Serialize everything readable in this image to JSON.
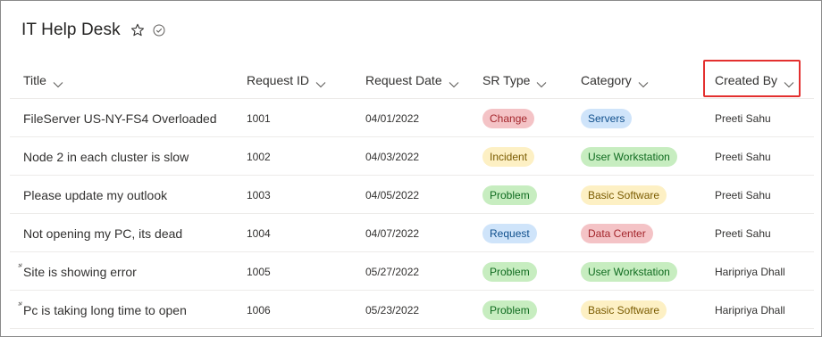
{
  "list": {
    "title": "IT Help Desk"
  },
  "columns": [
    {
      "key": "title",
      "label": "Title"
    },
    {
      "key": "request_id",
      "label": "Request ID"
    },
    {
      "key": "request_date",
      "label": "Request Date"
    },
    {
      "key": "sr_type",
      "label": "SR Type"
    },
    {
      "key": "category",
      "label": "Category"
    },
    {
      "key": "created_by",
      "label": "Created By"
    }
  ],
  "pill_colors": {
    "Change": {
      "bg": "#f4c3c6",
      "fg": "#a4262c"
    },
    "Incident": {
      "bg": "#fdf0c4",
      "fg": "#7a5b00"
    },
    "Problem": {
      "bg": "#c7edc0",
      "fg": "#0f6b1f"
    },
    "Request": {
      "bg": "#cfe4fa",
      "fg": "#0f4f8c"
    },
    "Servers": {
      "bg": "#cfe4fa",
      "fg": "#0f4f8c"
    },
    "User Workstation": {
      "bg": "#c7edc0",
      "fg": "#0f6b1f"
    },
    "Basic Software": {
      "bg": "#fdf0c4",
      "fg": "#7a5b00"
    },
    "Data Center": {
      "bg": "#f4c3c6",
      "fg": "#a4262c"
    }
  },
  "rows": [
    {
      "title": "FileServer US-NY-FS4 Overloaded",
      "request_id": "1001",
      "request_date": "04/01/2022",
      "sr_type": "Change",
      "category": "Servers",
      "created_by": "Preeti Sahu",
      "new_marker": false
    },
    {
      "title": "Node 2 in each cluster is slow",
      "request_id": "1002",
      "request_date": "04/03/2022",
      "sr_type": "Incident",
      "category": "User Workstation",
      "created_by": "Preeti Sahu",
      "new_marker": false
    },
    {
      "title": "Please update my outlook",
      "request_id": "1003",
      "request_date": "04/05/2022",
      "sr_type": "Problem",
      "category": "Basic Software",
      "created_by": "Preeti Sahu",
      "new_marker": false
    },
    {
      "title": "Not opening my PC, its dead",
      "request_id": "1004",
      "request_date": "04/07/2022",
      "sr_type": "Request",
      "category": "Data Center",
      "created_by": "Preeti Sahu",
      "new_marker": false
    },
    {
      "title": "Site is showing error",
      "request_id": "1005",
      "request_date": "05/27/2022",
      "sr_type": "Problem",
      "category": "User Workstation",
      "created_by": "Haripriya Dhall",
      "new_marker": true
    },
    {
      "title": "Pc is taking long time to open",
      "request_id": "1006",
      "request_date": "05/23/2022",
      "sr_type": "Problem",
      "category": "Basic Software",
      "created_by": "Haripriya Dhall",
      "new_marker": true
    }
  ],
  "highlight_color": "#e3302f"
}
